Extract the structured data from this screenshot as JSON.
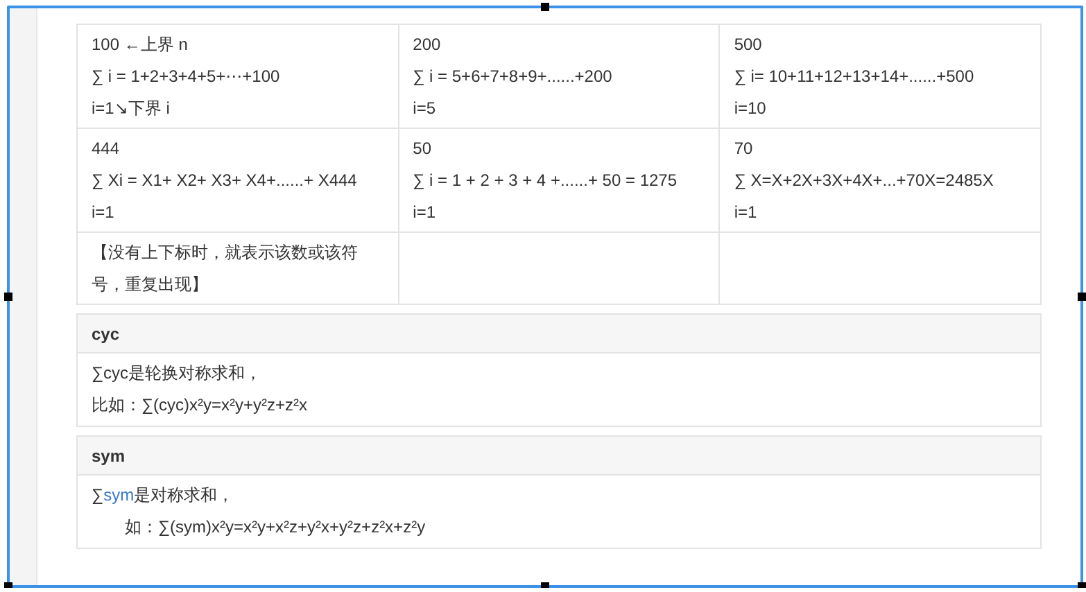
{
  "table": {
    "rows": [
      {
        "cells": [
          {
            "lines": [
              "100 ←上界 n",
              "∑ i = 1+2+3+4+5+⋯+100",
              "i=1↘下界 i"
            ]
          },
          {
            "lines": [
              "200",
              "∑ i = 5+6+7+8+9+......+200",
              "i=5"
            ]
          },
          {
            "lines": [
              "500",
              "∑ i= 10+11+12+13+14+......+500",
              "i=10"
            ]
          }
        ]
      },
      {
        "cells": [
          {
            "lines": [
              "444",
              "∑ Xi = X1+ X2+ X3+ X4+......+ X444",
              "i=1"
            ]
          },
          {
            "lines": [
              "50",
              "∑ i = 1 + 2 + 3 + 4 +......+ 50 = 1275",
              "i=1"
            ]
          },
          {
            "lines": [
              "70",
              "∑ X=X+2X+3X+4X+...+70X=2485X",
              "i=1"
            ]
          }
        ]
      },
      {
        "cells": [
          {
            "lines": [
              "【没有上下标时，就表示该数或该符号，重复出现】"
            ]
          },
          {},
          {}
        ]
      }
    ]
  },
  "panels": [
    {
      "title": "cyc",
      "lines": [
        {
          "parts": [
            {
              "text": "∑cyc是轮换对称求和，",
              "highlight": false
            }
          ]
        },
        {
          "parts": [
            {
              "text": "比如：∑(cyc)x²y=x²y+y²z+z²x",
              "highlight": false
            }
          ]
        }
      ]
    },
    {
      "title": "sym",
      "lines": [
        {
          "parts": [
            {
              "text": "∑",
              "highlight": false
            },
            {
              "text": "sym",
              "highlight": true
            },
            {
              "text": "是对称求和，",
              "highlight": false
            }
          ]
        },
        {
          "parts": [
            {
              "text": "　　如：∑(sym)x²y=x²y+x²z+y²x+y²z+z²x+z²y",
              "highlight": false
            }
          ]
        }
      ]
    }
  ]
}
